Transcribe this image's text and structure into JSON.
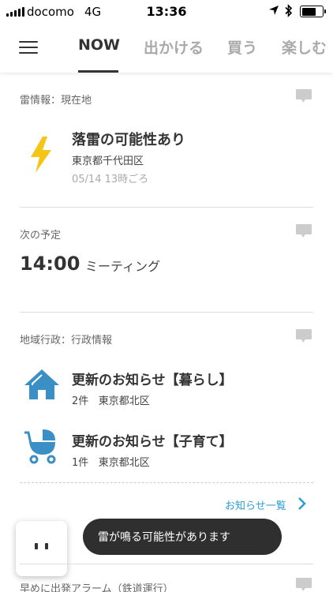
{
  "status_bar": {
    "carrier": "docomo",
    "network": "4G",
    "time": "13:36"
  },
  "tabs": [
    {
      "label": "NOW",
      "active": true
    },
    {
      "label": "出かける",
      "active": false
    },
    {
      "label": "買う",
      "active": false
    },
    {
      "label": "楽しむ",
      "active": false
    }
  ],
  "lightning": {
    "section_title": "雷情報：現在地",
    "title": "落雷の可能性あり",
    "place": "東京都千代田区",
    "time": "05/14 13時ごろ",
    "icon": "lightning-bolt-icon",
    "icon_color": "#f5c518"
  },
  "schedule": {
    "section_title": "次の予定",
    "time": "14:00",
    "title": "ミーティング"
  },
  "admin_info": {
    "section_title": "地域行政：行政情報",
    "items": [
      {
        "title": "更新のお知らせ【暮らし】",
        "count": "2件",
        "area": "東京都北区",
        "icon": "house-icon"
      },
      {
        "title": "更新のお知らせ【子育て】",
        "count": "1件",
        "area": "東京都北区",
        "icon": "stroller-icon"
      }
    ],
    "more_label": "お知らせ一覧",
    "icon_color": "#3a8fc4",
    "link_color": "#2b9bd6"
  },
  "toast": {
    "message": "雷が鳴る可能性があります"
  },
  "alarm": {
    "section_title": "早めに出発アラーム（鉄道運行）"
  }
}
